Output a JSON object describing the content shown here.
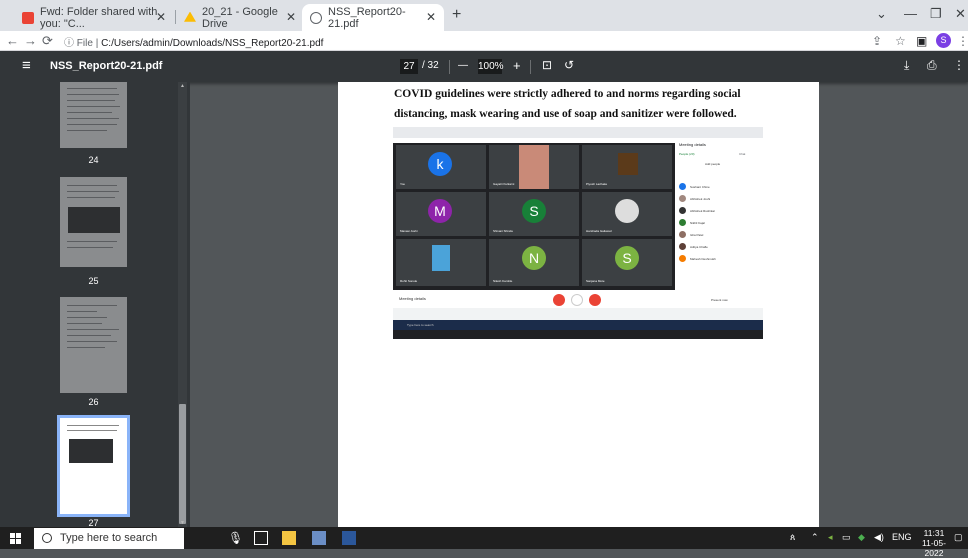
{
  "tabs": [
    {
      "label": "Fwd: Folder shared with you: \"C...",
      "icon": "gmail-icon",
      "color": "#ea4335"
    },
    {
      "label": "20_21 - Google Drive",
      "icon": "drive-icon",
      "color": "#fbbc04"
    },
    {
      "label": "NSS_Report20-21.pdf",
      "icon": "globe-icon",
      "color": "#5f6368"
    }
  ],
  "address": {
    "prefix": "File",
    "url": "C:/Users/admin/Downloads/NSS_Report20-21.pdf"
  },
  "profile_initial": "S",
  "pdf": {
    "title": "NSS_Report20-21.pdf",
    "current_page": "27",
    "total_pages": "/ 32",
    "zoom": "100%",
    "minus": "—",
    "plus": "+"
  },
  "thumbnails": [
    {
      "label": "24"
    },
    {
      "label": "25"
    },
    {
      "label": "26"
    },
    {
      "label": "27"
    }
  ],
  "page": {
    "line1": "COVID guidelines were strictly adhered to and norms regarding social",
    "line2": "distancing, mask wearing and use of soap and sanitizer were followed."
  },
  "meet": {
    "tiles": [
      {
        "initial": "k",
        "color": "#1a73e8",
        "name": "You"
      },
      {
        "initial": "",
        "color": "#c98a78",
        "name": "Gayatri Kulkarni"
      },
      {
        "initial": "",
        "color": "#5b3a1a",
        "name": "Piyush Lachake"
      },
      {
        "initial": "M",
        "color": "#8e24aa",
        "name": "Manasi Joshi"
      },
      {
        "initial": "S",
        "color": "#188038",
        "name": "Shivani Shinde"
      },
      {
        "initial": "",
        "color": "#444",
        "name": "Harshada Gaikwad"
      },
      {
        "initial": "",
        "color": "#4ba3d9",
        "name": "Rohit Sonule"
      },
      {
        "initial": "N",
        "color": "#7cb342",
        "name": "Nilesh Kamble"
      },
      {
        "initial": "S",
        "color": "#7cb342",
        "name": "Sanjana Mote"
      }
    ],
    "panel_title": "Meeting details",
    "panel_tab1": "People (20)",
    "panel_tab2": "Chat",
    "add_people": "Add people",
    "participants": [
      "Sushant Chine",
      "Abhishek Joshi",
      "Abhishek Rushikar",
      "Nikhil Kajal",
      "Isha Patel",
      "Aditya Chafle",
      "Mahesh Deshmukh"
    ],
    "bottom_left": "Meeting details",
    "bottom_right": "Present now",
    "mini_search": "Type here to search"
  },
  "taskbar": {
    "search_placeholder": "Type here to search",
    "lang": "ENG",
    "time": "11:31",
    "date": "11-05-2022"
  }
}
